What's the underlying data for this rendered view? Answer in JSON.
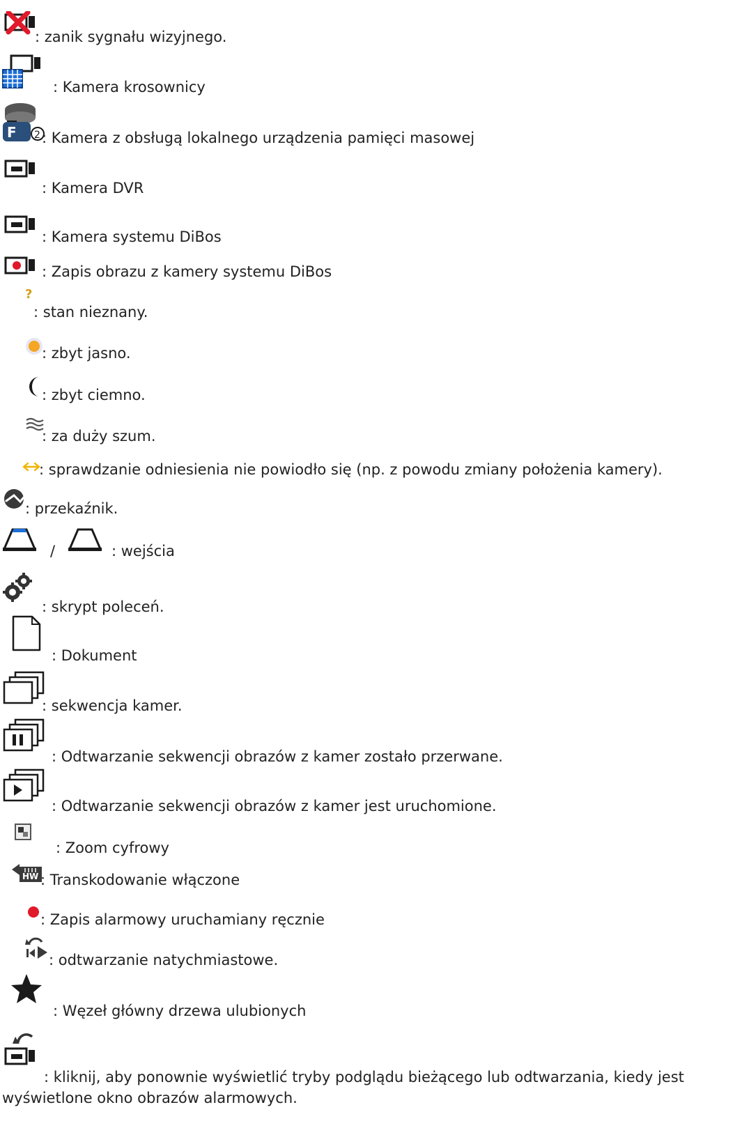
{
  "items": [
    {
      "icon": "video-signal-loss-icon",
      "text": ": zanik sygnału wizyjnego."
    },
    {
      "icon": "matrix-camera-icon",
      "text": ": Kamera krosownicy"
    },
    {
      "icon": "local-storage-camera-icon",
      "text": ": Kamera z obsługą lokalnego urządzenia pamięci masowej"
    },
    {
      "icon": "dvr-camera-icon",
      "text": ": Kamera DVR"
    },
    {
      "icon": "dibos-camera-icon",
      "text": ": Kamera systemu DiBos"
    },
    {
      "icon": "dibos-recording-camera-icon",
      "text": ": Zapis obrazu z kamery systemu DiBos"
    },
    {
      "icon": "unknown-state-icon",
      "text": ": stan nieznany."
    },
    {
      "icon": "too-bright-icon",
      "text": ": zbyt jasno."
    },
    {
      "icon": "too-dark-icon",
      "text": ": zbyt ciemno."
    },
    {
      "icon": "too-noisy-icon",
      "text": ": za duży szum."
    },
    {
      "icon": "reference-check-failed-icon",
      "text": ": sprawdzanie odniesienia nie powiodło się (np. z powodu zmiany położenia kamery)."
    },
    {
      "icon": "relay-icon",
      "text": ": przekaźnik."
    },
    {
      "icon": "input-icons",
      "separator": "/",
      "text": ": wejścia"
    },
    {
      "icon": "command-script-icon",
      "text": ": skrypt poleceń."
    },
    {
      "icon": "document-icon",
      "text": ": Dokument"
    },
    {
      "icon": "camera-sequence-icon",
      "text": ": sekwencja kamer."
    },
    {
      "icon": "sequence-paused-icon",
      "text": ": Odtwarzanie sekwencji obrazów z kamer zostało przerwane."
    },
    {
      "icon": "sequence-playing-icon",
      "text": ": Odtwarzanie sekwencji obrazów z kamer jest uruchomione."
    },
    {
      "icon": "digital-zoom-icon",
      "text": ": Zoom cyfrowy"
    },
    {
      "icon": "transcoding-icon",
      "text": ": Transkodowanie włączone"
    },
    {
      "icon": "manual-alarm-recording-icon",
      "text": ": Zapis alarmowy uruchamiany ręcznie"
    },
    {
      "icon": "instant-playback-icon",
      "text": ": odtwarzanie natychmiastowe."
    },
    {
      "icon": "favorites-root-icon",
      "text": ": Węzeł główny drzewa ulubionych"
    },
    {
      "icon": "return-to-live-icon",
      "text": ": kliknij, aby ponownie wyświetlić tryby podglądu bieżącego lub odtwarzania, kiedy jest wyświetlone okno obrazów alarmowych."
    }
  ],
  "colors": {
    "text": "#222222",
    "camera": "#1a1a1a",
    "red": "#e0192b",
    "blue": "#1c6fd8",
    "orange": "#f5a623",
    "yellow_q": "#d4a017"
  }
}
